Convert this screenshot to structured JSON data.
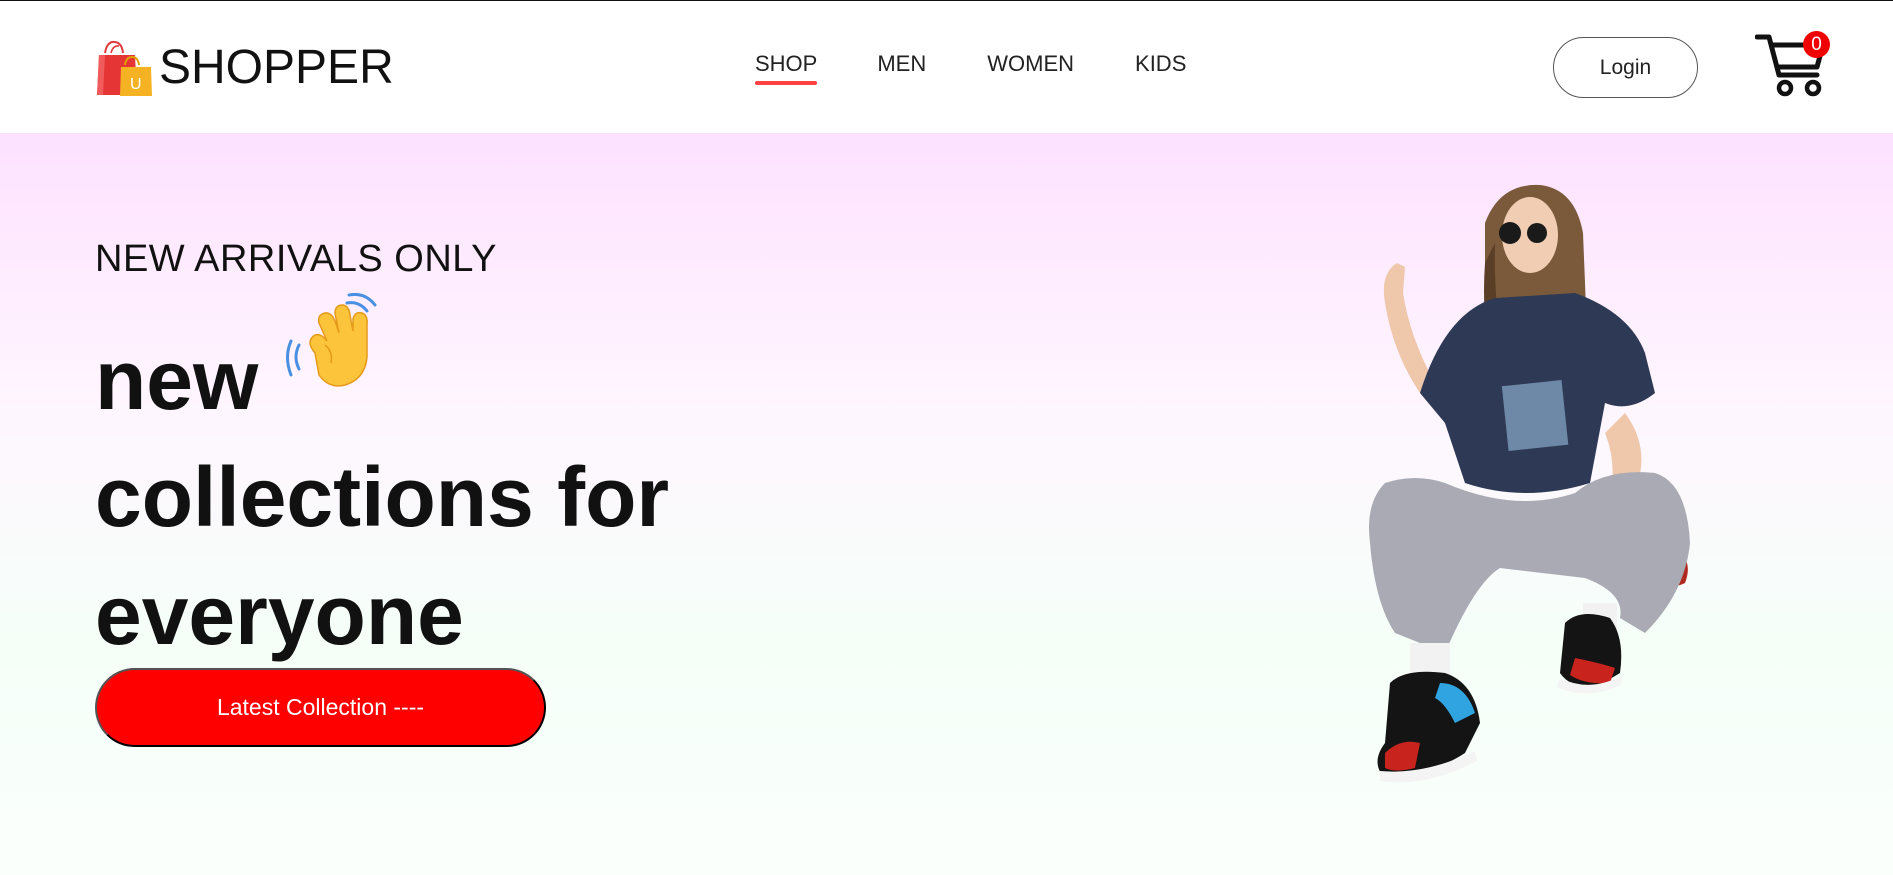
{
  "brand": {
    "name": "SHOPPER",
    "logo_icon": "shopping-bags-icon",
    "logo_letter": "U"
  },
  "nav": {
    "items": [
      {
        "label": "SHOP",
        "active": true
      },
      {
        "label": "MEN",
        "active": false
      },
      {
        "label": "WOMEN",
        "active": false
      },
      {
        "label": "KIDS",
        "active": false
      }
    ],
    "active_underline_color": "#ff4141"
  },
  "header": {
    "login_label": "Login",
    "cart_icon": "cart-icon",
    "cart_count": "0",
    "cart_badge_color": "#f00000"
  },
  "hero": {
    "kicker": "NEW ARRIVALS ONLY",
    "headline": [
      "new",
      "collections for",
      "everyone"
    ],
    "hand_icon": "waving-hand-icon",
    "cta_label": "Latest Collection ----",
    "cta_color": "#ff0000",
    "image": "model-photo"
  }
}
